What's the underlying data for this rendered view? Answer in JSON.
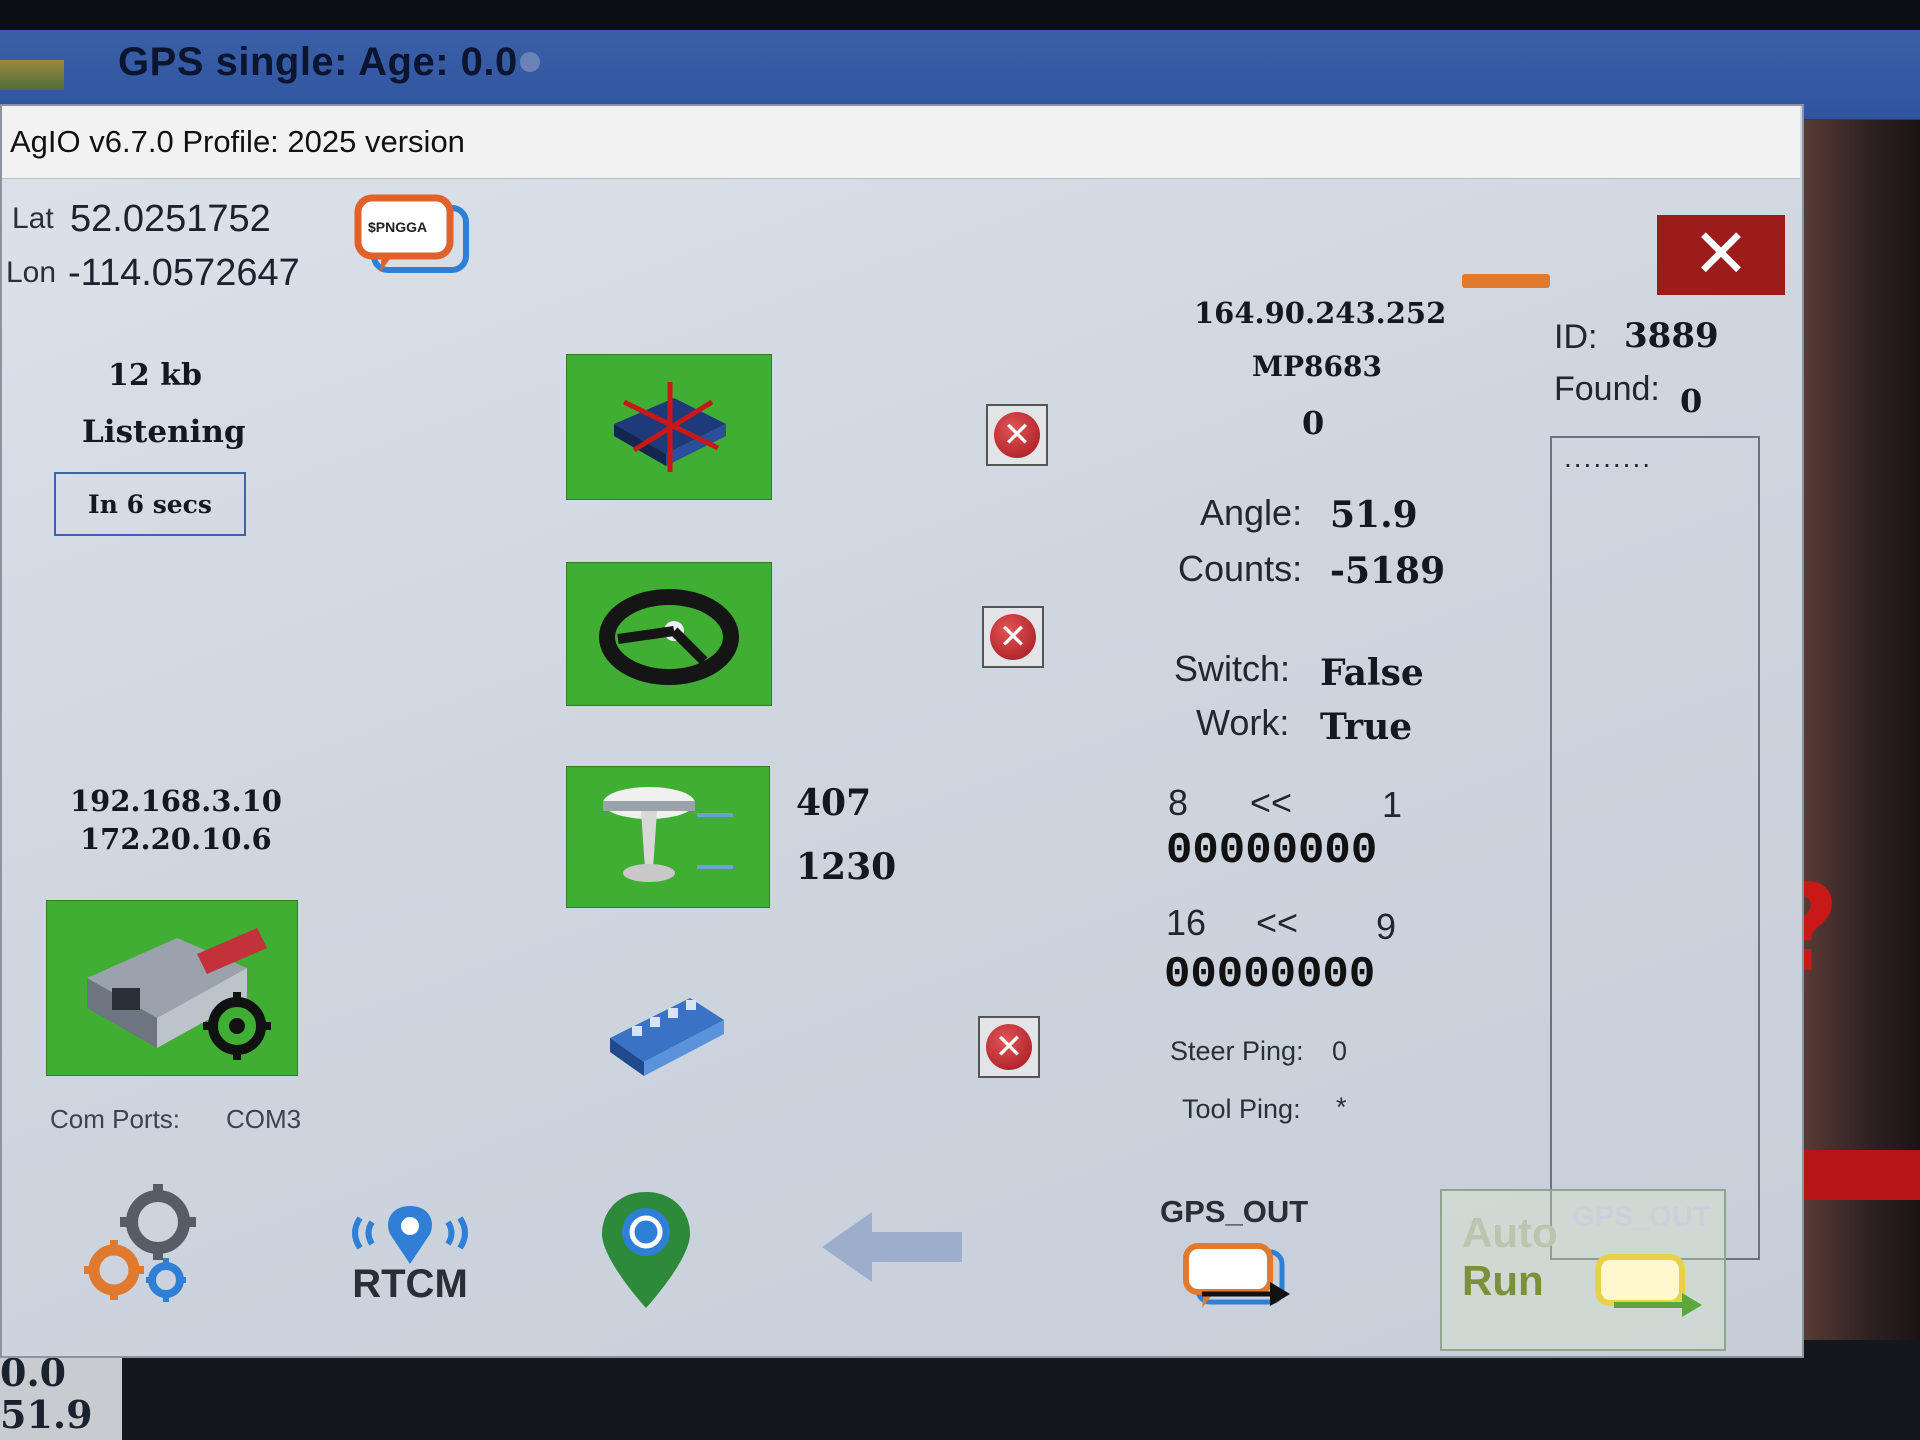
{
  "main_app": {
    "status_title": "GPS single: Age: 0.0",
    "bottom_left_values": [
      "0.0",
      "51.9"
    ]
  },
  "dialog": {
    "title": "AgIO  v6.7.0 Profile: 2025 version",
    "close_icon": "close-x-icon",
    "position": {
      "lat_label": "Lat",
      "lat_value": "52.0251752",
      "lon_label": "Lon",
      "lon_value": "-114.0572647"
    },
    "nmea_icon": "nmea-message-icon",
    "nmea_icon_text": "$PNGGA",
    "ntrip": {
      "data_size": "12 kb",
      "status": "Listening",
      "countdown": "In 6 secs"
    },
    "network": {
      "ip_1": "192.168.3.10",
      "ip_2": "172.20.10.6"
    },
    "com_ports_label": "Com Ports:",
    "com_ports_value": "COM3",
    "modules": {
      "imu_icon": "imu-board-icon",
      "steer_icon": "steering-wheel-icon",
      "gps_icon": "gps-antenna-icon",
      "machine_icon": "machine-relay-board-icon",
      "gps_in_count": "407",
      "gps_out_count": "1230"
    },
    "caster": {
      "ip": "164.90.243.252",
      "mount": "MP8683",
      "count": "0"
    },
    "id_label": "ID:",
    "id_value": "3889",
    "found_label": "Found:",
    "found_value": "0",
    "list_placeholder": ".........",
    "steer": {
      "angle_label": "Angle:",
      "angle_value": "51.9",
      "counts_label": "Counts:",
      "counts_value": "-5189",
      "switch_label": "Switch:",
      "switch_value": "False",
      "work_label": "Work:",
      "work_value": "True"
    },
    "sections": {
      "row1_high": "8",
      "row1_arrow": "<<",
      "row1_low": "1",
      "row1_bits": "00000000",
      "row2_high": "16",
      "row2_arrow": "<<",
      "row2_low": "9",
      "row2_bits": "00000000"
    },
    "pings": {
      "steer_label": "Steer Ping:",
      "steer_value": "0",
      "tool_label": "Tool Ping:",
      "tool_value": "*"
    },
    "bottom_toolbar": {
      "settings_icon": "settings-gears-icon",
      "rtcm_label": "RTCM",
      "location_icon": "location-pin-icon",
      "back_icon": "back-arrow-icon",
      "gps_out_label": "GPS_OUT",
      "auto_run_line1": "Auto",
      "auto_run_line2": "Run",
      "auto_run_gps_out": "GPS_OUT"
    }
  },
  "colors": {
    "dialog_bg": "#d3d9e2",
    "module_green": "#3fae32",
    "close_red": "#9c1c1c",
    "topbar_blue": "#3a5fa6"
  }
}
